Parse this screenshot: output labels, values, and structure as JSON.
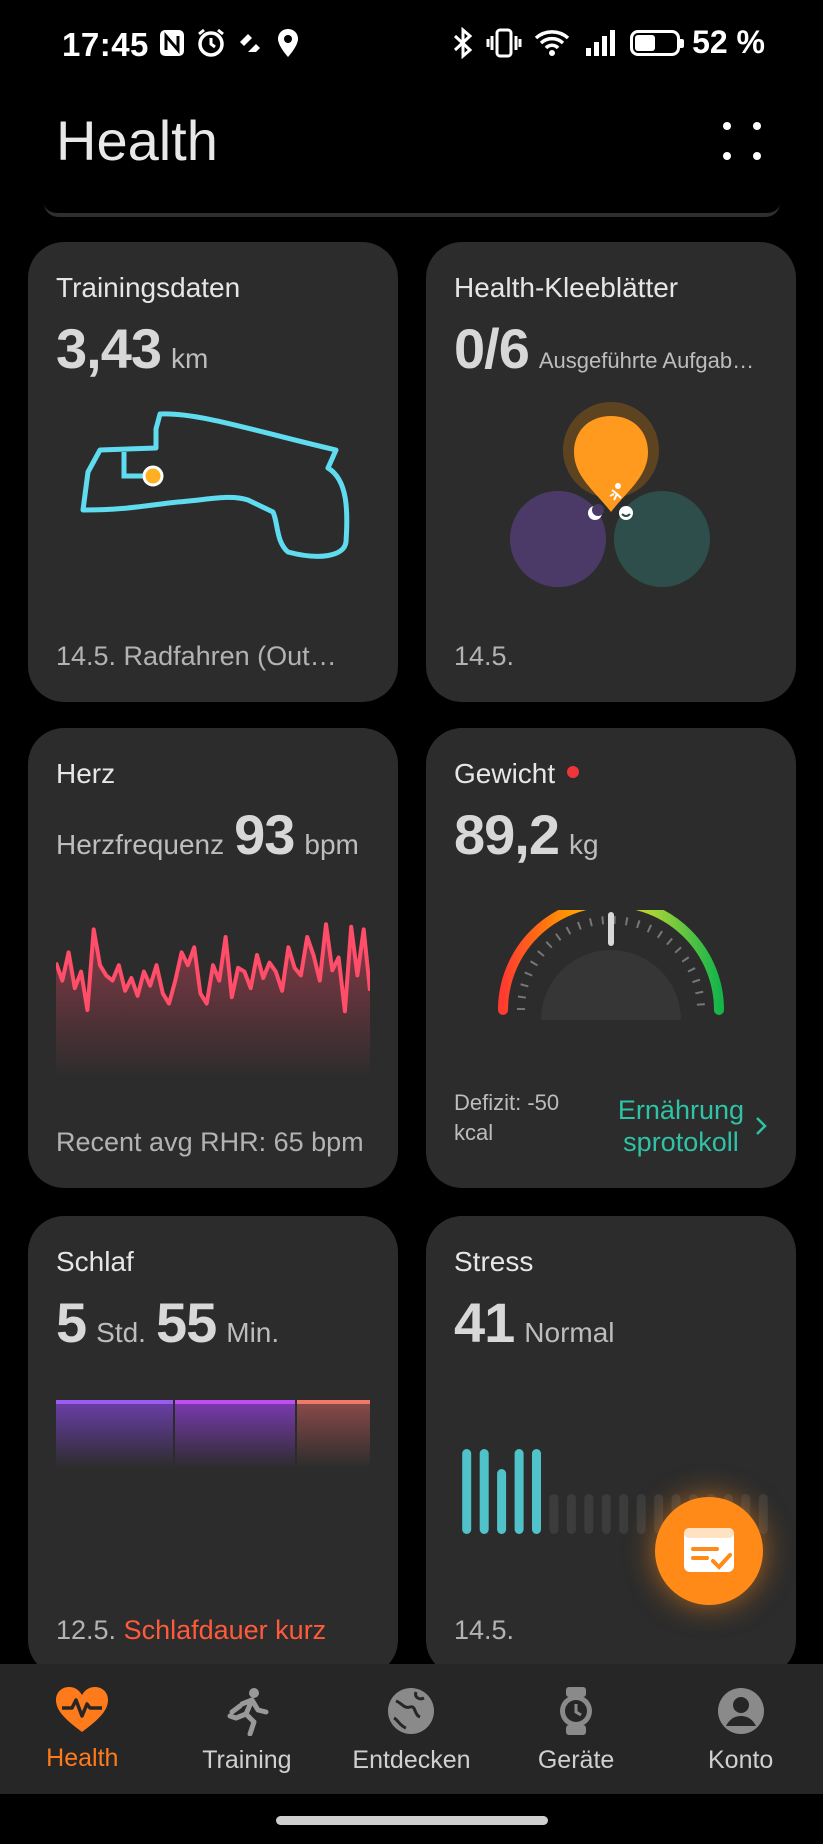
{
  "status_bar": {
    "time": "17:45",
    "battery_percent": "52 %",
    "battery_level": 0.52
  },
  "app": {
    "title": "Health"
  },
  "cards": {
    "training": {
      "title": "Trainingsdaten",
      "value": "3,43",
      "unit": "km",
      "footer": "14.5. Radfahren (Out…"
    },
    "clover": {
      "title": "Health-Kleeblätter",
      "value": "0/6",
      "label": "Ausgeführte Aufgab…",
      "footer": "14.5."
    },
    "heart": {
      "title": "Herz",
      "label": "Herzfrequenz",
      "value": "93",
      "unit": "bpm",
      "footer": "Recent avg RHR: 65 bpm",
      "trace": [
        62,
        48,
        70,
        42,
        55,
        25,
        88,
        60,
        52,
        48,
        60,
        40,
        50,
        36,
        55,
        44,
        60,
        38,
        30,
        48,
        70,
        60,
        74,
        38,
        30,
        60,
        48,
        82,
        35,
        58,
        55,
        42,
        68,
        50,
        62,
        55,
        40,
        74,
        58,
        52,
        82,
        68,
        48,
        92,
        56,
        66,
        24,
        90,
        52,
        88,
        40
      ]
    },
    "weight": {
      "title": "Gewicht",
      "value": "89,2",
      "unit": "kg",
      "deficit": "Defizit: -50 kcal",
      "link_line1": "Ernährung",
      "link_line2": "sprotokoll"
    },
    "sleep": {
      "title": "Schlaf",
      "hours": "5",
      "hours_unit": "Std.",
      "minutes": "55",
      "minutes_unit": "Min.",
      "footer_date": "12.5.",
      "footer_warning": "Schlafdauer kurz"
    },
    "stress": {
      "title": "Stress",
      "value": "41",
      "label": "Normal",
      "footer": "14.5.",
      "bars_active": [
        0.85,
        0.85,
        0.65,
        0.85,
        0.85
      ],
      "bars_inactive": 13
    }
  },
  "tabs": [
    {
      "label": "Health",
      "icon": "heart-pulse-icon",
      "active": true
    },
    {
      "label": "Training",
      "icon": "runner-icon",
      "active": false
    },
    {
      "label": "Entdecken",
      "icon": "globe-icon",
      "active": false
    },
    {
      "label": "Geräte",
      "icon": "watch-icon",
      "active": false
    },
    {
      "label": "Konto",
      "icon": "account-icon",
      "active": false
    }
  ],
  "colors": {
    "accent": "#ff7a1a",
    "route": "#5fdcf0",
    "heart": "#ff4d6a",
    "stress": "#4fc3c9",
    "link": "#2fc2a6"
  }
}
